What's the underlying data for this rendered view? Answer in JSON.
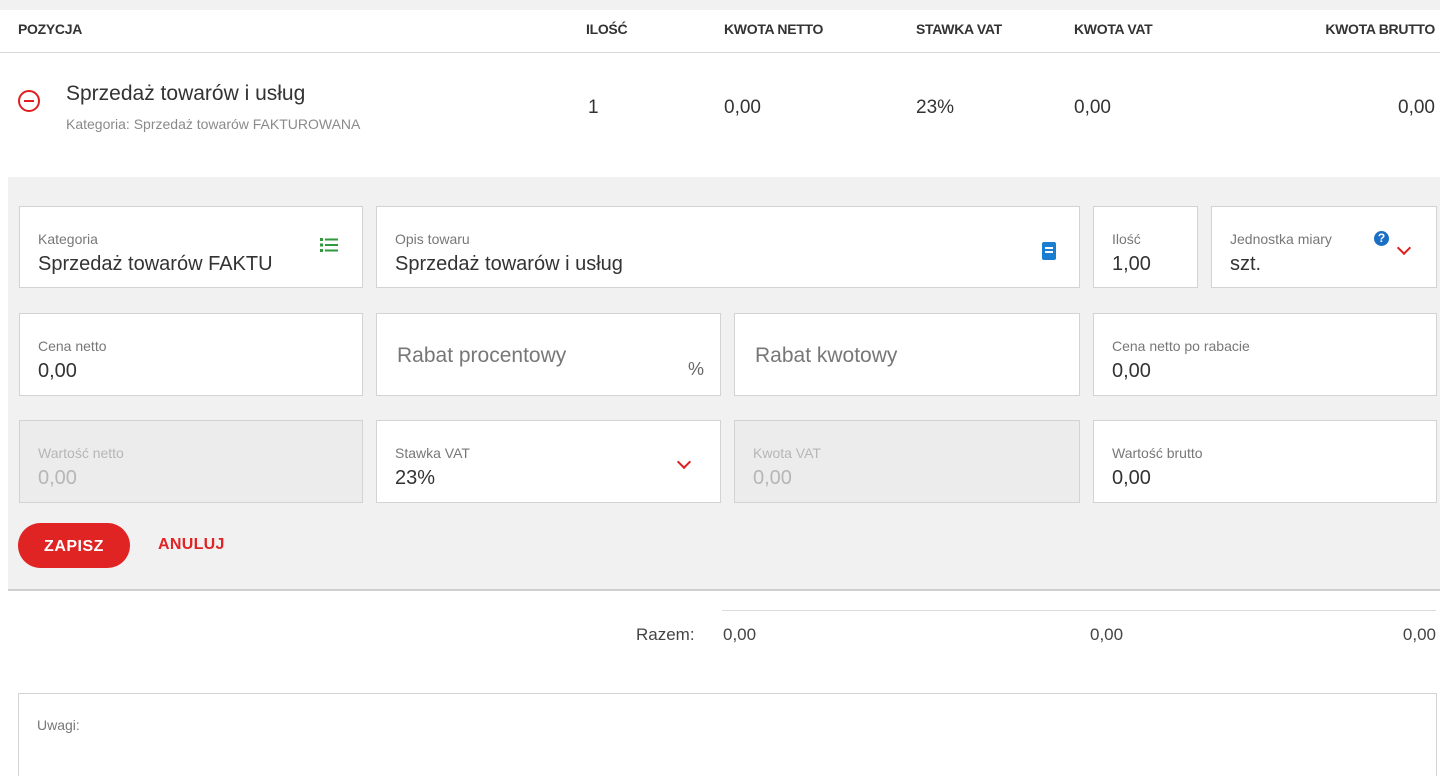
{
  "table_header": {
    "pozycja": "POZYCJA",
    "ilosc": "ILOŚĆ",
    "kwota_netto": "KWOTA NETTO",
    "stawka_vat": "STAWKA VAT",
    "kwota_vat": "KWOTA VAT",
    "kwota_brutto": "KWOTA BRUTTO"
  },
  "item": {
    "name": "Sprzedaż towarów i usług",
    "category": "Kategoria: Sprzedaż towarów FAKTUROWANA",
    "ilosc": "1",
    "kwota_netto": "0,00",
    "stawka_vat": "23%",
    "kwota_vat": "0,00",
    "kwota_brutto": "0,00"
  },
  "form": {
    "kategoria": {
      "label": "Kategoria",
      "value": "Sprzedaż towarów FAKTU"
    },
    "opis": {
      "label": "Opis towaru",
      "value": "Sprzedaż towarów i usług"
    },
    "ilosc": {
      "label": "Ilość",
      "value": "1,00"
    },
    "jednostka": {
      "label": "Jednostka miary",
      "value": "szt."
    },
    "cena_netto": {
      "label": "Cena netto",
      "value": "0,00"
    },
    "rabat_procentowy": {
      "placeholder": "Rabat procentowy",
      "suffix": "%"
    },
    "rabat_kwotowy": {
      "placeholder": "Rabat kwotowy"
    },
    "cena_po_rabacie": {
      "label": "Cena netto po rabacie",
      "value": "0,00"
    },
    "wartosc_netto": {
      "label": "Wartość netto",
      "value": "0,00"
    },
    "stawka_vat": {
      "label": "Stawka VAT",
      "value": "23%"
    },
    "kwota_vat": {
      "label": "Kwota VAT",
      "value": "0,00"
    },
    "wartosc_brutto": {
      "label": "Wartość brutto",
      "value": "0,00"
    }
  },
  "actions": {
    "save": "ZAPISZ",
    "cancel": "ANULUJ"
  },
  "totals": {
    "label": "Razem:",
    "netto": "0,00",
    "vat": "0,00",
    "brutto": "0,00"
  },
  "notes": {
    "label": "Uwagi:"
  },
  "colors": {
    "accent": "#e02424",
    "list_icon": "#2e9a3a",
    "book_icon": "#1a7fd0",
    "help_icon": "#1a6fc4"
  },
  "icons": [
    "minus-circle-icon",
    "list-icon",
    "book-icon",
    "help-icon",
    "chevron-down-icon"
  ]
}
